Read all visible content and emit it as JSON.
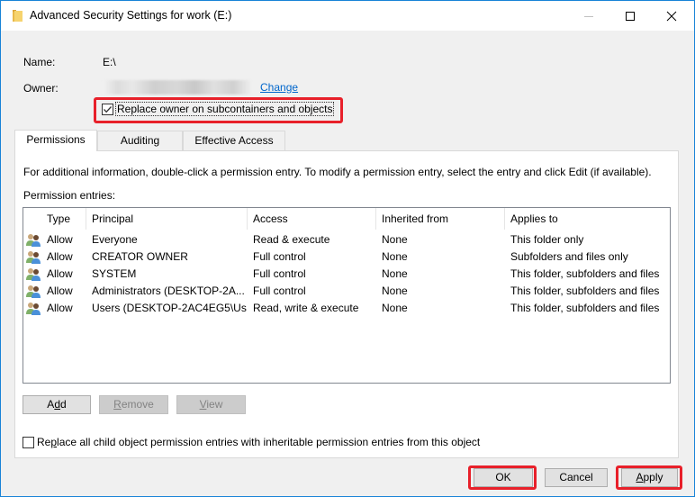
{
  "window": {
    "title": "Advanced Security Settings for work (E:)",
    "icon": "folder-icon",
    "controls": {
      "minimize": "minimize-icon",
      "maximize": "maximize-icon",
      "close": "close-icon"
    }
  },
  "header": {
    "name_label": "Name:",
    "name_value": "E:\\",
    "owner_label": "Owner:",
    "owner_value_redacted": true,
    "change_link": "Change",
    "replace_owner_checkbox": {
      "label": "Replace owner on subcontainers and objects",
      "checked": true
    }
  },
  "tabs": [
    {
      "label": "Permissions",
      "active": true
    },
    {
      "label": "Auditing",
      "active": false
    },
    {
      "label": "Effective Access",
      "active": false
    }
  ],
  "permissions": {
    "info_text": "For additional information, double-click a permission entry. To modify a permission entry, select the entry and click Edit (if available).",
    "entries_label": "Permission entries:",
    "columns": [
      "Type",
      "Principal",
      "Access",
      "Inherited from",
      "Applies to"
    ],
    "rows": [
      {
        "icon": "users-icon",
        "type": "Allow",
        "principal": "Everyone",
        "access": "Read & execute",
        "inherited_from": "None",
        "applies_to": "This folder only"
      },
      {
        "icon": "users-icon",
        "type": "Allow",
        "principal": "CREATOR OWNER",
        "access": "Full control",
        "inherited_from": "None",
        "applies_to": "Subfolders and files only"
      },
      {
        "icon": "users-icon",
        "type": "Allow",
        "principal": "SYSTEM",
        "access": "Full control",
        "inherited_from": "None",
        "applies_to": "This folder, subfolders and files"
      },
      {
        "icon": "users-icon",
        "type": "Allow",
        "principal": "Administrators (DESKTOP-2A...",
        "access": "Full control",
        "inherited_from": "None",
        "applies_to": "This folder, subfolders and files"
      },
      {
        "icon": "users-icon",
        "type": "Allow",
        "principal": "Users (DESKTOP-2AC4EG5\\Us...",
        "access": "Read, write & execute",
        "inherited_from": "None",
        "applies_to": "This folder, subfolders and files"
      }
    ],
    "buttons": {
      "add": {
        "pre": "A",
        "accel": "d",
        "post": "d",
        "enabled": true
      },
      "remove": {
        "pre": "",
        "accel": "R",
        "post": "emove",
        "enabled": false
      },
      "view": {
        "pre": "",
        "accel": "V",
        "post": "iew",
        "enabled": false
      }
    },
    "replace_child_checkbox": {
      "pre": "Re",
      "accel": "p",
      "post": "lace all child object permission entries with inheritable permission entries from this object",
      "checked": false
    }
  },
  "footer": {
    "ok": "OK",
    "cancel": "Cancel",
    "apply_accel": "A",
    "apply_rest": "pply"
  },
  "highlight_color": "#e8202a",
  "link_color": "#0066cc"
}
